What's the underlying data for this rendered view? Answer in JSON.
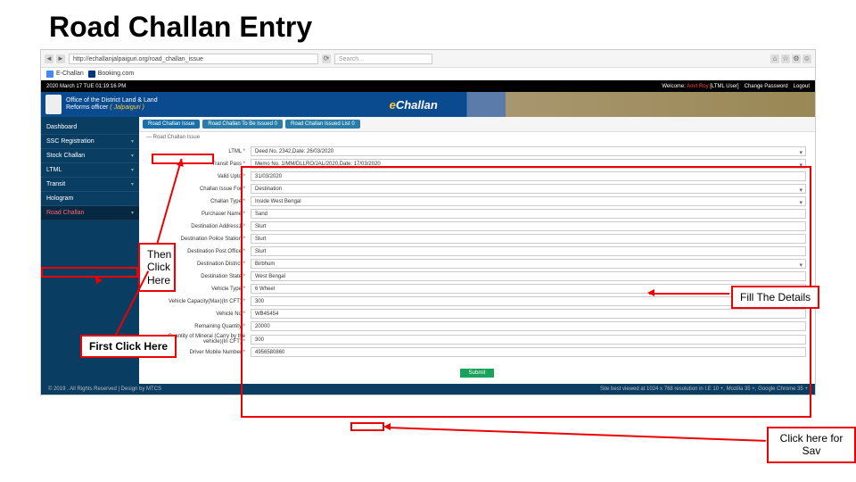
{
  "slide": {
    "title": "Road Challan Entry"
  },
  "browser": {
    "url": "http://echallanjalpaiguri.org/road_challan_issue",
    "search_placeholder": "Search...",
    "favs": [
      "E-Challan",
      "Booking.com"
    ]
  },
  "topbar": {
    "datetime": "2020 March 17 TUE  01:19:16 PM",
    "welcome": "Welcome: ",
    "user": "Amit Roy",
    "role": " [LTML User]",
    "change_pw": "Change Password",
    "logout": "Logout"
  },
  "header": {
    "office_line1": "Office of the District Land & Land",
    "office_line2": "Reforms officer",
    "district": "( Jalpaiguri )",
    "logo_e": "e",
    "logo_rest": "Challan"
  },
  "sidebar": {
    "items": [
      {
        "label": "Dashboard"
      },
      {
        "label": "SSC Registration"
      },
      {
        "label": "Stock Challan"
      },
      {
        "label": "LTML"
      },
      {
        "label": "Transit"
      },
      {
        "label": "Hologram"
      },
      {
        "label": "Road Challan"
      }
    ]
  },
  "tabs": {
    "t1": "Road Challan Issue",
    "t2": "Road Challan To Be Issued 0",
    "t3": "Road Challan Issued List 0"
  },
  "breadcrumb": "— Road Challan Issue",
  "form": {
    "ltml": {
      "label": "LTML",
      "value": "Deed No. 2342,Date: 26/03/2020"
    },
    "transit": {
      "label": "Transit Pass",
      "value": "Memo No. 1/MM/DLLRO/JAL/2020,Date: 17/03/2020"
    },
    "valid": {
      "label": "Valid Upto",
      "value": "31/03/2020"
    },
    "issuefor": {
      "label": "Challan Issue For",
      "value": "Destination"
    },
    "ctype": {
      "label": "Challan Type",
      "value": "Inside West Bengal"
    },
    "pname": {
      "label": "Purchaser Name",
      "value": "Sand"
    },
    "daddr": {
      "label": "Destination Address1",
      "value": "Slurt"
    },
    "dps": {
      "label": "Destination Police Station",
      "value": "Slurt"
    },
    "dpo": {
      "label": "Destination Post Office",
      "value": "Slurt"
    },
    "ddist": {
      "label": "Destination District",
      "value": "Birbhum"
    },
    "dstate": {
      "label": "Destination State",
      "value": "West Bengal"
    },
    "vtype": {
      "label": "Vehicle Type",
      "value": "6 Wheel"
    },
    "vcap": {
      "label": "Vehicle Capacity(Max)(In CFT)",
      "value": "300"
    },
    "vno": {
      "label": "Vehicle No",
      "value": "WB45454"
    },
    "rqty": {
      "label": "Remaining Quantity",
      "value": "20000"
    },
    "qmin": {
      "label": "Quantity of Mineral (Carry by the vehicle)(In CFT)",
      "value": "300"
    },
    "dmob": {
      "label": "Driver Mobile Number",
      "value": "4956580860"
    },
    "submit": "Submit"
  },
  "footer": {
    "left": "© 2019 . All Rights Reserved | Design by MTCS",
    "right": "Site best viewed at 1024 x 768 resolution in I.E 10 +, Mozilla 35 +, Google Chrome 35 +"
  },
  "annot": {
    "then": "Then Click Here",
    "first": "First Click Here",
    "fill": "Fill The Details",
    "save": "Click here for Sav"
  }
}
